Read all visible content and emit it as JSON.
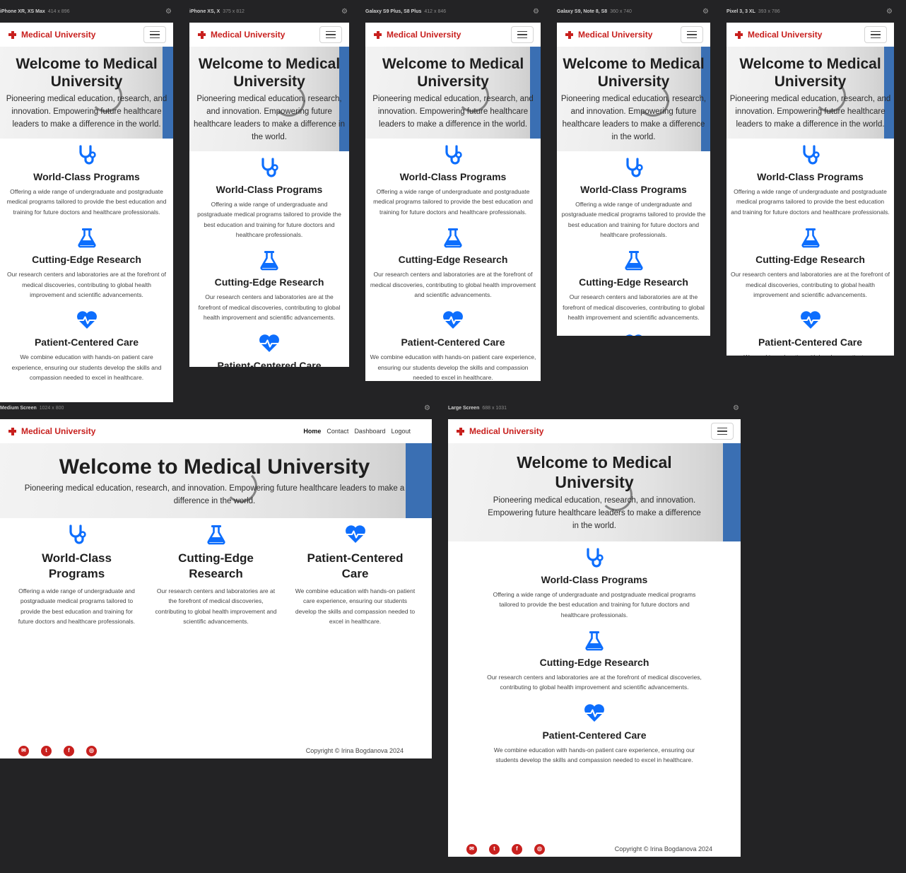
{
  "brand": "Medical University",
  "nav": {
    "home": "Home",
    "contact": "Contact",
    "dashboard": "Dashboard",
    "logout": "Logout"
  },
  "hero": {
    "title": "Welcome to Medical University",
    "subtitle": "Pioneering medical education, research, and innovation. Empowering future healthcare leaders to make a difference in the world."
  },
  "features": [
    {
      "icon": "stethoscope-icon",
      "title": "World-Class Programs",
      "text": "Offering a wide range of undergraduate and postgraduate medical programs tailored to provide the best education and training for future doctors and healthcare professionals."
    },
    {
      "icon": "flask-icon",
      "title": "Cutting-Edge Research",
      "text": "Our research centers and laboratories are at the forefront of medical discoveries, contributing to global health improvement and scientific advancements."
    },
    {
      "icon": "heartbeat-icon",
      "title": "Patient-Centered Care",
      "text": "We combine education with hands-on patient care experience, ensuring our students develop the skills and compassion needed to excel in healthcare."
    }
  ],
  "footer": {
    "copyright": "Copyright © Irina Bogdanova 2024",
    "socials": [
      "envelope-icon",
      "twitter-icon",
      "facebook-icon",
      "instagram-icon"
    ]
  },
  "devices": [
    {
      "name": "iPhone XR, XS Max",
      "size": "414 x 896"
    },
    {
      "name": "iPhone XS, X",
      "size": "375 x 812"
    },
    {
      "name": "Galaxy S9 Plus, S8 Plus",
      "size": "412 x 846"
    },
    {
      "name": "Galaxy S9, Note 8, S8",
      "size": "360 x 740"
    },
    {
      "name": "Pixel 3, 3 XL",
      "size": "393 x 786"
    },
    {
      "name": "Medium Screen",
      "size": "1024 x 800"
    },
    {
      "name": "Large Screen",
      "size": "688 x 1031"
    }
  ],
  "colors": {
    "brand": "#c8201e",
    "icon": "#0d6efd",
    "canvas": "#232325"
  }
}
